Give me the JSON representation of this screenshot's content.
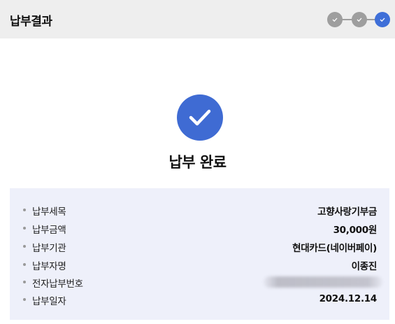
{
  "header": {
    "title": "납부결과",
    "steps": [
      {
        "state": "done",
        "icon": "check-icon"
      },
      {
        "state": "done",
        "icon": "check-icon"
      },
      {
        "state": "current",
        "icon": "check-icon"
      }
    ]
  },
  "result": {
    "icon": "check-circle-icon",
    "title": "납부 완료"
  },
  "details": [
    {
      "label": "납부세목",
      "value": "고향사랑기부금"
    },
    {
      "label": "납부금액",
      "value": "30,000원"
    },
    {
      "label": "납부기관",
      "value": "현대카드(네이버페이)"
    },
    {
      "label": "납부자명",
      "value": "이종진"
    },
    {
      "label": "전자납부번호",
      "value": ""
    },
    {
      "label": "납부일자",
      "value": "2024.12.14"
    }
  ],
  "colors": {
    "accent": "#3f6bd3",
    "step_done": "#9e9e9e",
    "panel_bg": "#eef0fa",
    "header_bg": "#eeeeee"
  }
}
